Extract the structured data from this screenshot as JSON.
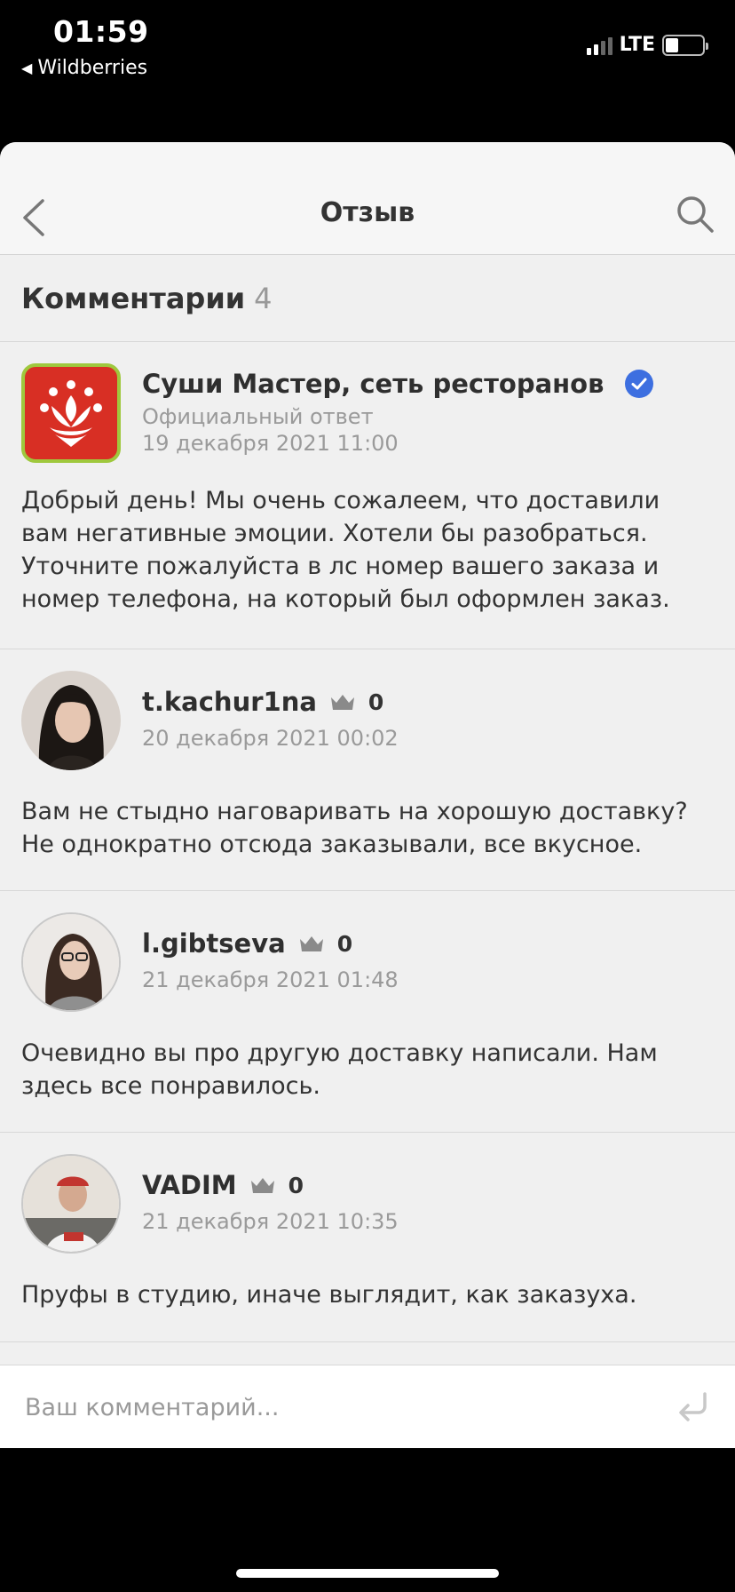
{
  "status_bar": {
    "time": "01:59",
    "back_app": "Wildberries",
    "network": "LTE"
  },
  "nav": {
    "title": "Отзыв",
    "back_icon": "chevron-left-icon",
    "search_icon": "search-icon"
  },
  "comments_header": {
    "label": "Комментарии",
    "count": "4"
  },
  "comments": [
    {
      "author": "Суши Мастер, сеть ресторанов",
      "badge": "Официальный ответ",
      "date": "19 декабря 2021 11:00",
      "text": "Добрый день! Мы очень сожалеем, что доставили вам негативные эмоции. Хотели бы разобраться. Уточните пожалуйста в лс номер вашего заказа и номер телефона, на который был оформлен заказ.",
      "verified": true,
      "brand_color": "#d82f24"
    },
    {
      "author": "t.kachur1na",
      "rating": "0",
      "date": "20 декабря 2021 00:02",
      "text": "Вам не стыдно наговаривать на хорошую доставку? Не однократно отсюда заказывали, все вкусное."
    },
    {
      "author": "l.gibtseva",
      "rating": "0",
      "date": "21 декабря 2021 01:48",
      "text": "Очевидно вы про другую доставку написали. Нам здесь все понравилось."
    },
    {
      "author": "VADIM",
      "rating": "0",
      "date": "21 декабря 2021 10:35",
      "text": "Пруфы в студию, иначе выглядит, как заказуха."
    }
  ],
  "input": {
    "placeholder": "Ваш комментарий...",
    "value": ""
  },
  "colors": {
    "verified": "#3d6fe0",
    "accent_text": "#2b2b2b",
    "muted": "#9a9a9a"
  }
}
